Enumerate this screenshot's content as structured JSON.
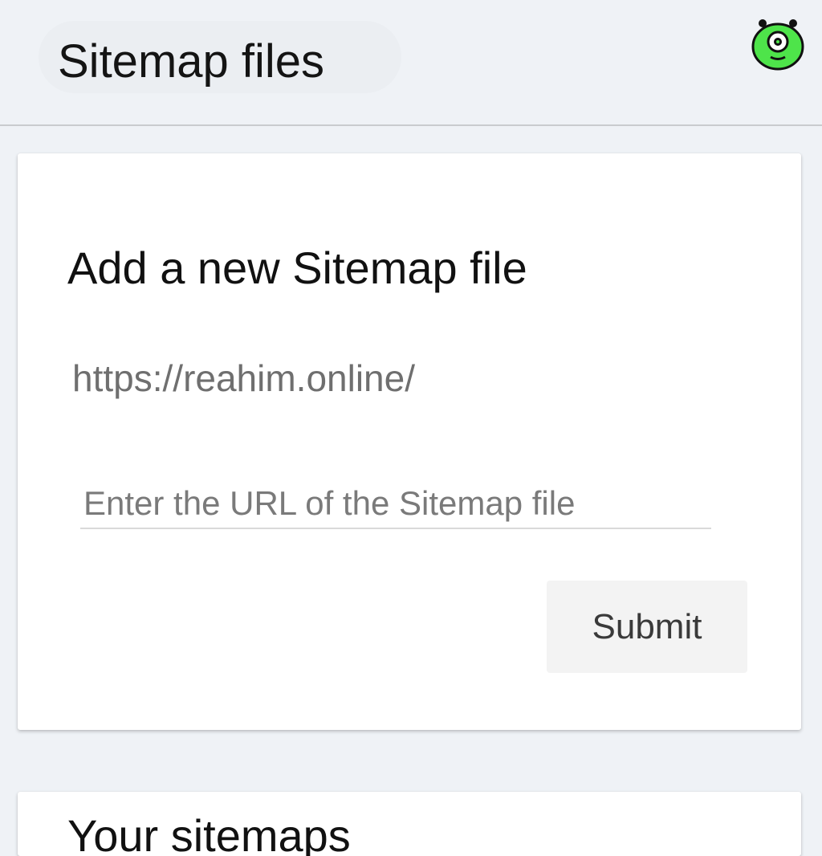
{
  "header": {
    "title": "Sitemap files",
    "avatar_icon": "green-monster-avatar-icon",
    "avatar_color": "#4ee44a"
  },
  "add_card": {
    "title": "Add a new Sitemap file",
    "base_url": "https://reahim.online/",
    "input_placeholder": "Enter the URL of the Sitemap file",
    "input_value": "",
    "submit_label": "Submit"
  },
  "next_card": {
    "title_partial": "Your sitemaps"
  }
}
